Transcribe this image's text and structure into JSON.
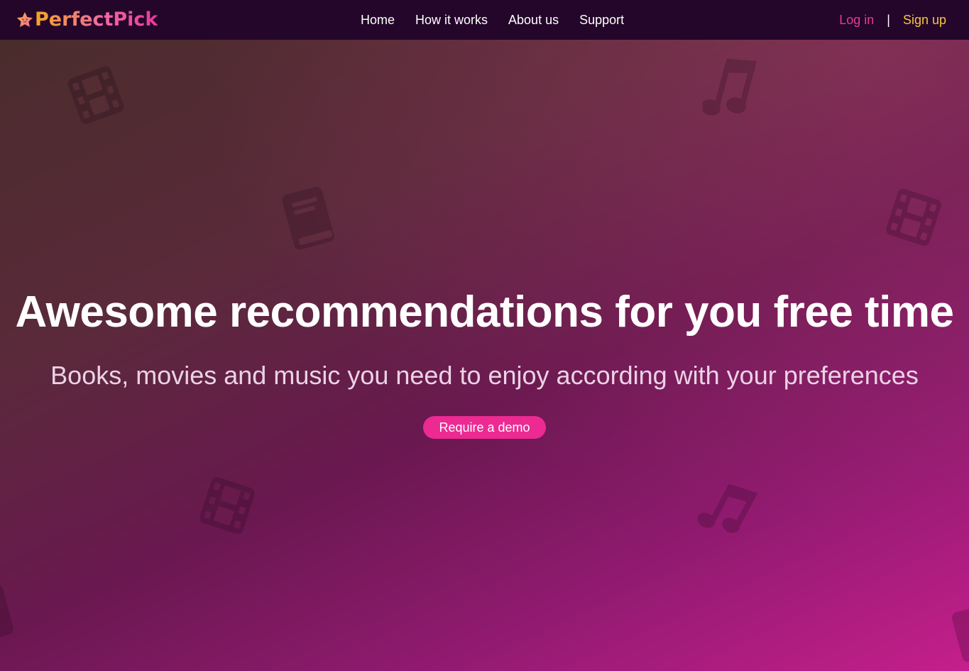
{
  "brand": {
    "name": "PerfectPick",
    "logo_icon": "star-icon",
    "logo_colors": [
      "#f5a623",
      "#e8399b"
    ]
  },
  "nav": {
    "links": [
      {
        "label": "Home"
      },
      {
        "label": "How it works"
      },
      {
        "label": "About us"
      },
      {
        "label": "Support"
      }
    ],
    "login_label": "Log in",
    "separator": "|",
    "signup_label": "Sign up"
  },
  "hero": {
    "title": "Awesome recommendations for you free time",
    "subtitle": "Books, movies and music you need to enjoy according with your preferences",
    "cta_label": "Require a demo",
    "background_icons": [
      "film-icon",
      "music-note-icon",
      "book-icon",
      "film-icon",
      "film-icon",
      "music-note-icon"
    ]
  },
  "colors": {
    "navbar_bg": "#24062a",
    "accent_pink": "#ec2a92",
    "login_color": "#e23c98",
    "signup_color": "#f5c542"
  }
}
